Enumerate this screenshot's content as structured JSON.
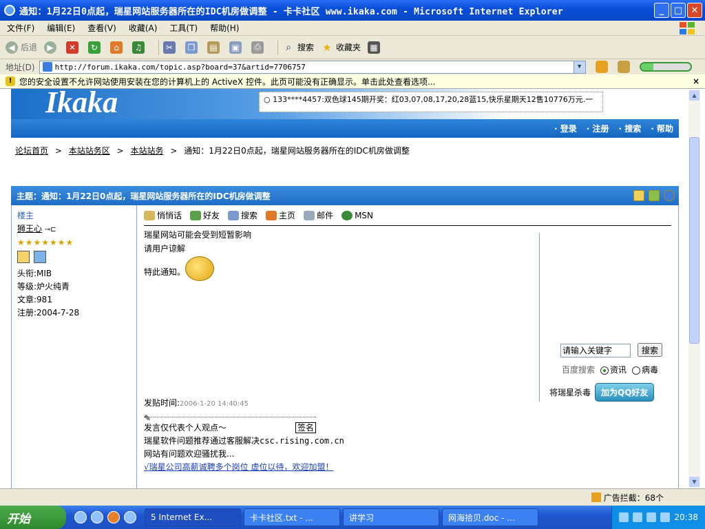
{
  "window": {
    "title": "通知：1月22日0点起，瑞星网站服务器所在的IDC机房做调整 - 卡卡社区 www.ikaka.com - Microsoft Internet Explorer"
  },
  "menu": [
    "文件(F)",
    "编辑(E)",
    "查看(V)",
    "收藏(A)",
    "工具(T)",
    "帮助(H)"
  ],
  "toolbar": {
    "back": "后退",
    "search": "搜索",
    "favorites": "收藏夹"
  },
  "address": {
    "label": "地址(D)",
    "url": "http://forum.ikaka.com/topic.asp?board=37&artid=7706757"
  },
  "infobar": {
    "text": "您的安全设置不允许网站使用安装在您的计算机上的 ActiveX 控件。此页可能没有正确显示。单击此处查看选项...",
    "close": "×"
  },
  "site": {
    "logo": "Ikaka",
    "ticker": "133****4457:双色球145期开奖：红03,07,08,17,20,28蓝15,快乐星期天12售10776万元.一",
    "nav": [
      "· 登录",
      "· 注册",
      "· 搜索",
      "· 帮助"
    ]
  },
  "breadcrumb": {
    "home": "论坛首页",
    "area": "本站站务区",
    "board": "本站站务",
    "current": "通知：1月22日0点起，瑞星网站服务器所在的IDC机房做调整",
    "sep": ">"
  },
  "topic": {
    "title": "主题：通知：1月22日0点起，瑞星网站服务器所在的IDC机房做调整"
  },
  "author": {
    "floor": "楼主",
    "name": "狮王心",
    "stars": "★★★★★★★",
    "rank": "头衔:MIB",
    "level": "等级:炉火纯青",
    "posts": "文章:981",
    "registered": "注册:2004-7-28"
  },
  "actions": [
    "悄悄话",
    "好友",
    "搜索",
    "主页",
    "邮件",
    "MSN"
  ],
  "post": {
    "line1": "瑞星网站可能会受到短暂影响",
    "line2": "请用户谅解",
    "line3": "特此通知。",
    "time_label": "发贴时间:",
    "time": "2006-1-20 14:40:45",
    "sig1": "发言仅代表个人观点～",
    "sign_button": "签名",
    "sig2": "瑞星软件问题推荐通过客服解决csc.rising.com.cn",
    "sig3": "网站有问题欢迎骚扰我...",
    "sig_link": "√瑞星公司高薪诚聘多个岗位 虚位以待，欢迎加盟！"
  },
  "ad": {
    "search_placeholder": "请输入关键字",
    "search_button": "搜索",
    "baidu": "百度搜索",
    "opt1": "资讯",
    "opt2": "病毒",
    "qq_label": "将瑞星杀毒",
    "qq_button": "加为QQ好友"
  },
  "status": {
    "popup": "广告拦截：68个"
  },
  "taskbar": {
    "start": "开始",
    "tasks": [
      "5 Internet Ex...",
      "卡卡社区.txt - ...",
      "讲学习",
      "网海拾贝.doc - ..."
    ],
    "clock": "20:38"
  }
}
